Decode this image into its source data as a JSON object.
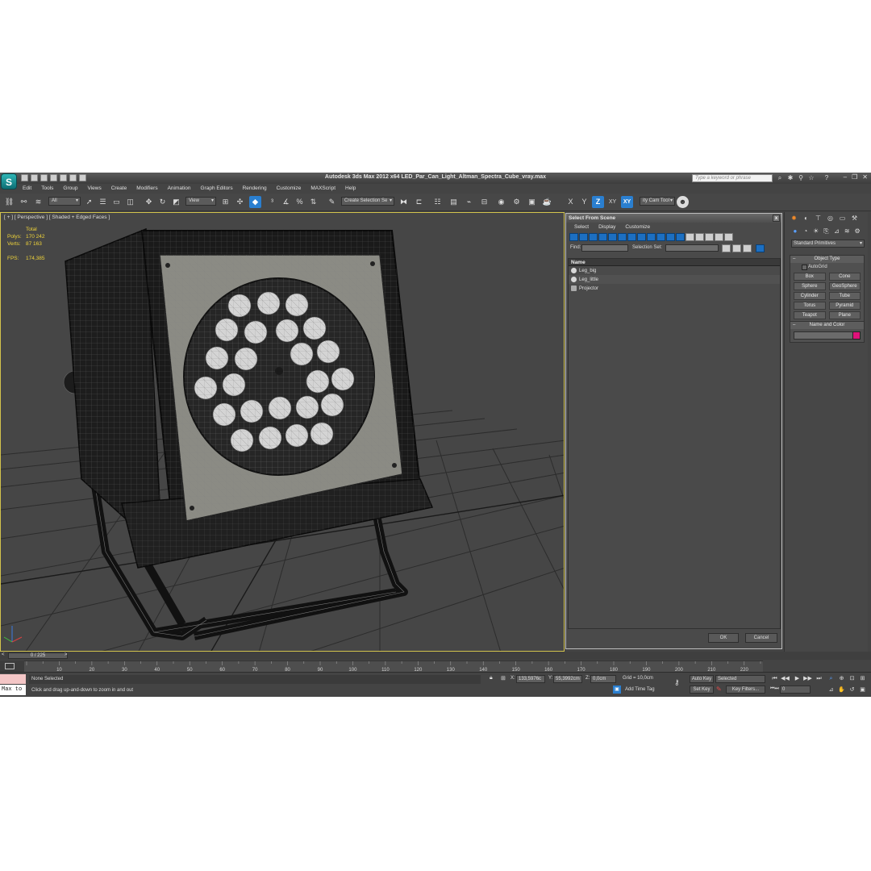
{
  "app": {
    "logo_glyph": "S",
    "title": "Autodesk 3ds Max  2012 x64     LED_Par_Can_Light_Altman_Spectra_Cube_vray.max",
    "search_placeholder": "Type a keyword or phrase"
  },
  "menu": [
    "Edit",
    "Tools",
    "Group",
    "Views",
    "Create",
    "Modifiers",
    "Animation",
    "Graph Editors",
    "Rendering",
    "Customize",
    "MAXScript",
    "Help"
  ],
  "toolbar": {
    "selection_filter": "All",
    "ref_coord": "View",
    "named_selection": "Create Selection Se",
    "axis_x": "X",
    "axis_y": "Y",
    "axis_z": "Z",
    "axis_xy": "XY",
    "axis_xy2": "XY",
    "cam_tool": "ity Cam Tool"
  },
  "viewport": {
    "label": "[ + ] [ Perspective ] [ Shaded + Edged Faces ]",
    "stats_header": "Total",
    "stats": [
      {
        "label": "Polys:",
        "value": "170 242"
      },
      {
        "label": "Verts:",
        "value": "87 163"
      }
    ],
    "fps_label": "FPS:",
    "fps_value": "174,385",
    "accent_color": "#d2c34c"
  },
  "dialog": {
    "title": "Select From Scene",
    "close": "x",
    "menu": [
      "Select",
      "Display",
      "Customize"
    ],
    "find_label": "Find:",
    "selection_set_label": "Selection Set:",
    "column_name": "Name",
    "items": [
      "Leg_big",
      "Leg_little",
      "Projector"
    ],
    "ok": "OK",
    "cancel": "Cancel"
  },
  "command_panel": {
    "dropdown": "Standard Primitives",
    "object_type_title": "Object Type",
    "autogrid": "AutoGrid",
    "objects": [
      "Box",
      "Cone",
      "Sphere",
      "GeoSphere",
      "Cylinder",
      "Tube",
      "Torus",
      "Pyramid",
      "Teapot",
      "Plane"
    ],
    "name_color_title": "Name and Color",
    "object_color": "#e0127a"
  },
  "timeline": {
    "slider": "0 / 225",
    "ticks": [
      "10",
      "20",
      "30",
      "40",
      "50",
      "60",
      "70",
      "80",
      "90",
      "100",
      "110",
      "120",
      "130",
      "140",
      "150",
      "160",
      "170",
      "180",
      "190",
      "200",
      "210",
      "220"
    ]
  },
  "status": {
    "maxscript": "Max to",
    "selection": "None Selected",
    "prompt": "Click and drag up-and-down to zoom in and out",
    "x_label": "X:",
    "x_value": "133,5976c",
    "y_label": "Y:",
    "y_value": "55,3992cm",
    "z_label": "Z:",
    "z_value": "0,0cm",
    "grid": "Grid = 10,0cm",
    "add_time_tag": "Add Time Tag",
    "auto_key": "Auto Key",
    "set_key": "Set Key",
    "key_mode": "Selected",
    "key_filters": "Key Filters...",
    "frame": "0"
  }
}
